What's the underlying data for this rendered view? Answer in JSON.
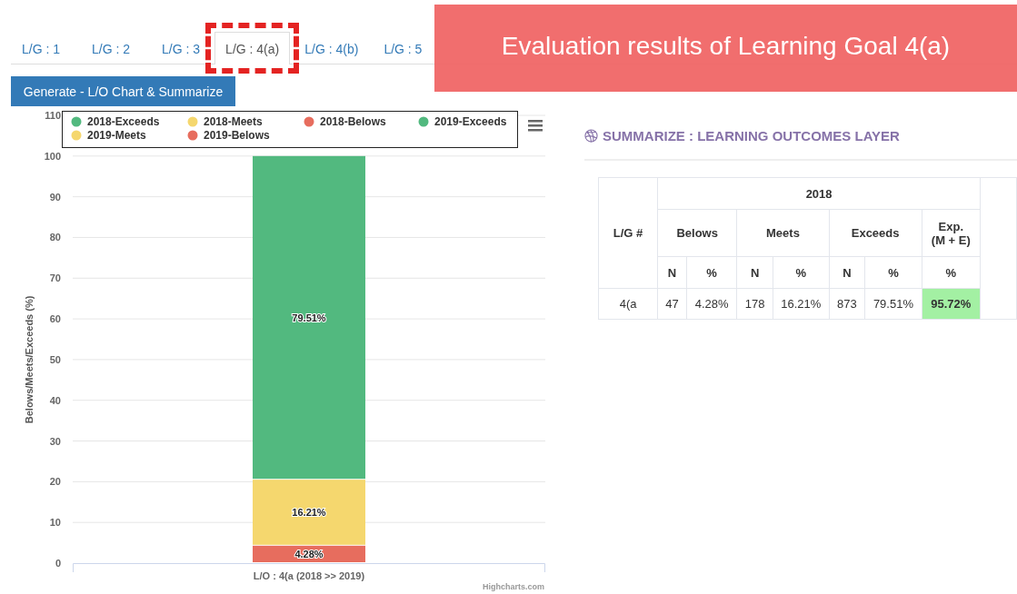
{
  "tabs": [
    {
      "label": "L/G : 1",
      "selected": false
    },
    {
      "label": "L/G : 2",
      "selected": false
    },
    {
      "label": "L/G : 3",
      "selected": false
    },
    {
      "label": "L/G : 4(a)",
      "selected": true
    },
    {
      "label": "L/G : 4(b)",
      "selected": false
    },
    {
      "label": "L/G : 5",
      "selected": false
    }
  ],
  "annotation": {
    "title": "Evaluation results of Learning Goal 4(a)",
    "highlight_selected_tab": true
  },
  "generate_button": "Generate - L/O Chart & Summarize",
  "chart": {
    "credit": "Highcharts.com",
    "chart_data": {
      "type": "bar",
      "orientation": "vertical",
      "stacked": true,
      "ylabel": "Belows/Meets/Exceeds (%)",
      "categories": [
        "L/O : 4(a (2018 >> 2019)"
      ],
      "ylim": [
        0,
        110
      ],
      "grid": true,
      "legend": true,
      "yticks": [
        0,
        10,
        20,
        30,
        40,
        50,
        60,
        70,
        80,
        90,
        100,
        110
      ],
      "data_labels": true,
      "series": [
        {
          "name": "2018-Exceeds",
          "color": "#52b97f",
          "values": [
            79.51
          ],
          "value_labels": [
            "79.51%"
          ]
        },
        {
          "name": "2018-Meets",
          "color": "#f5d76e",
          "values": [
            16.21
          ],
          "value_labels": [
            "16.21%"
          ]
        },
        {
          "name": "2018-Belows",
          "color": "#e76d5e",
          "values": [
            4.28
          ],
          "value_labels": [
            "4.28%"
          ]
        },
        {
          "name": "2019-Exceeds",
          "color": "#52b97f",
          "values": [
            null
          ],
          "value_labels": [
            null
          ]
        },
        {
          "name": "2019-Meets",
          "color": "#f5d76e",
          "values": [
            null
          ],
          "value_labels": [
            null
          ]
        },
        {
          "name": "2019-Belows",
          "color": "#e76d5e",
          "values": [
            null
          ],
          "value_labels": [
            null
          ]
        }
      ]
    }
  },
  "summary": {
    "title": "SUMMARIZE : LEARNING OUTCOMES LAYER",
    "table": {
      "row_header": "L/G #",
      "year": "2018",
      "groups": [
        {
          "label": "Belows",
          "columns": [
            "N",
            "%"
          ]
        },
        {
          "label": "Meets",
          "columns": [
            "N",
            "%"
          ]
        },
        {
          "label": "Exceeds",
          "columns": [
            "N",
            "%"
          ]
        },
        {
          "label": "Exp.\n(M + E)",
          "columns": [
            "%"
          ]
        }
      ],
      "rows": [
        {
          "cells": [
            {
              "text": "4(a",
              "highlight": false
            },
            {
              "text": "47",
              "highlight": false
            },
            {
              "text": "4.28%",
              "highlight": false
            },
            {
              "text": "178",
              "highlight": false
            },
            {
              "text": "16.21%",
              "highlight": false
            },
            {
              "text": "873",
              "highlight": false
            },
            {
              "text": "79.51%",
              "highlight": false
            },
            {
              "text": "95.72%",
              "highlight": true
            }
          ]
        }
      ]
    }
  }
}
